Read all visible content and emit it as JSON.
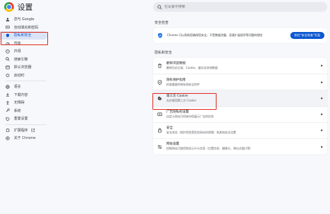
{
  "header": {
    "title": "设置",
    "search_placeholder": "在设置中搜索"
  },
  "sidebar": {
    "items": [
      {
        "label": "您与 Google",
        "icon": "person-icon"
      },
      {
        "label": "自动填充和密码",
        "icon": "autofill-icon"
      },
      {
        "label": "隐私和安全",
        "icon": "shield-icon",
        "active": true
      },
      {
        "label": "性能",
        "icon": "speedometer-icon"
      },
      {
        "label": "外观",
        "icon": "palette-icon"
      },
      {
        "label": "搜索引擎",
        "icon": "search-icon"
      },
      {
        "label": "默认浏览器",
        "icon": "browser-icon"
      },
      {
        "label": "启动时",
        "icon": "power-icon"
      },
      {
        "label": "语言",
        "icon": "globe-icon"
      },
      {
        "label": "下载内容",
        "icon": "download-icon"
      },
      {
        "label": "无障碍",
        "icon": "accessibility-icon"
      },
      {
        "label": "系统",
        "icon": "wrench-icon"
      },
      {
        "label": "重置设置",
        "icon": "reset-icon"
      },
      {
        "label": "扩展程序",
        "icon": "puzzle-icon"
      },
      {
        "label": "关于 Chrome",
        "icon": "chrome-icon"
      }
    ]
  },
  "safety_check": {
    "section_title": "安全检查",
    "text": "Chrome 可以帮助您确保您安全，不受数据泄露、恶意扩展程序等问题的侵扰",
    "button_label": "前往\"安全检查\"页面"
  },
  "privacy": {
    "section_title": "隐私和安全",
    "rows": [
      {
        "title": "删除浏览数据",
        "subtitle": "删除历史记录、Cookie、缓存及其他数据",
        "icon": "trash-icon"
      },
      {
        "title": "隐私保护指南",
        "subtitle": "检查重要的隐私和安全控件",
        "icon": "shield-check-icon"
      },
      {
        "title": "第三方 Cookie",
        "subtitle": "允许使用第三方 Cookie",
        "icon": "cookie-icon",
        "selected": true
      },
      {
        "title": "广告隐私权设置",
        "subtitle": "自定义网站可用来向您展示广告的信息",
        "icon": "ad-privacy-icon"
      },
      {
        "title": "安全",
        "subtitle": "安全浏览（保护您免受危险网站的侵害）和其他安全设置",
        "icon": "lock-icon"
      },
      {
        "title": "网站设置",
        "subtitle": "控制网站可使用和显示什么信息（位置信息、摄像头、弹出式窗口等）",
        "icon": "site-settings-icon"
      }
    ]
  },
  "colors": {
    "accent": "#0b57d0",
    "highlight": "#e0261c",
    "active_nav_bg": "#dbe4f6"
  }
}
